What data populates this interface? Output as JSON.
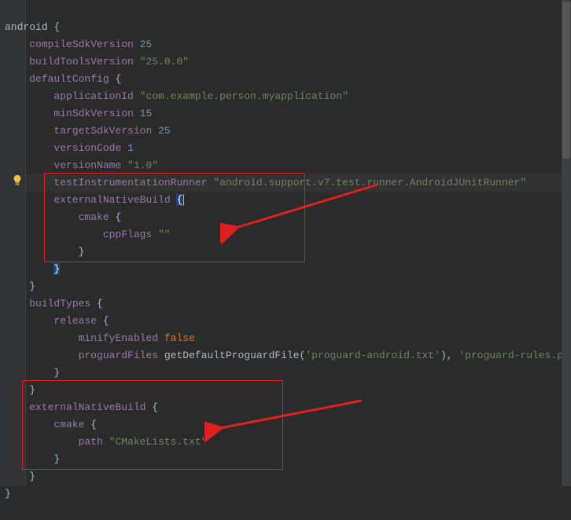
{
  "tokens": {
    "android": "android",
    "lbrace": "{",
    "rbrace": "}",
    "compileSdkVersion": "compileSdkVersion",
    "compileSdkVersion_val": "25",
    "buildToolsVersion": "buildToolsVersion",
    "buildToolsVersion_val": "\"25.0.0\"",
    "defaultConfig": "defaultConfig",
    "applicationId": "applicationId",
    "applicationId_val": "\"com.example.person.myapplication\"",
    "minSdkVersion": "minSdkVersion",
    "minSdkVersion_val": "15",
    "targetSdkVersion": "targetSdkVersion",
    "targetSdkVersion_val": "25",
    "versionCode": "versionCode",
    "versionCode_val": "1",
    "versionName": "versionName",
    "versionName_val": "\"1.0\"",
    "testInstrumentationRunner": "testInstrumentationRunner",
    "testInstrumentationRunner_val": "\"android.support.v7.test.runner.AndroidJUnitRunner\"",
    "externalNativeBuild": "externalNativeBuild",
    "cmake": "cmake",
    "cppFlags": "cppFlags",
    "cppFlags_val": "\"\"",
    "buildTypes": "buildTypes",
    "release": "release",
    "minifyEnabled": "minifyEnabled",
    "false": "false",
    "proguardFiles": "proguardFiles",
    "getDefaultProguardFile": "getDefaultProguardFile",
    "proguard_android": "'proguard-android.txt'",
    "comma_sp": ", ",
    "proguard_rules": "'proguard-rules.pro'",
    "path": "path",
    "path_val": "\"CMakeLists.txt\"",
    "sp1": "    ",
    "sp2": "        ",
    "sp3": "            ",
    "sp4": "                "
  },
  "colors": {
    "highlight_box": "#e02020",
    "arrow": "#e02020"
  }
}
